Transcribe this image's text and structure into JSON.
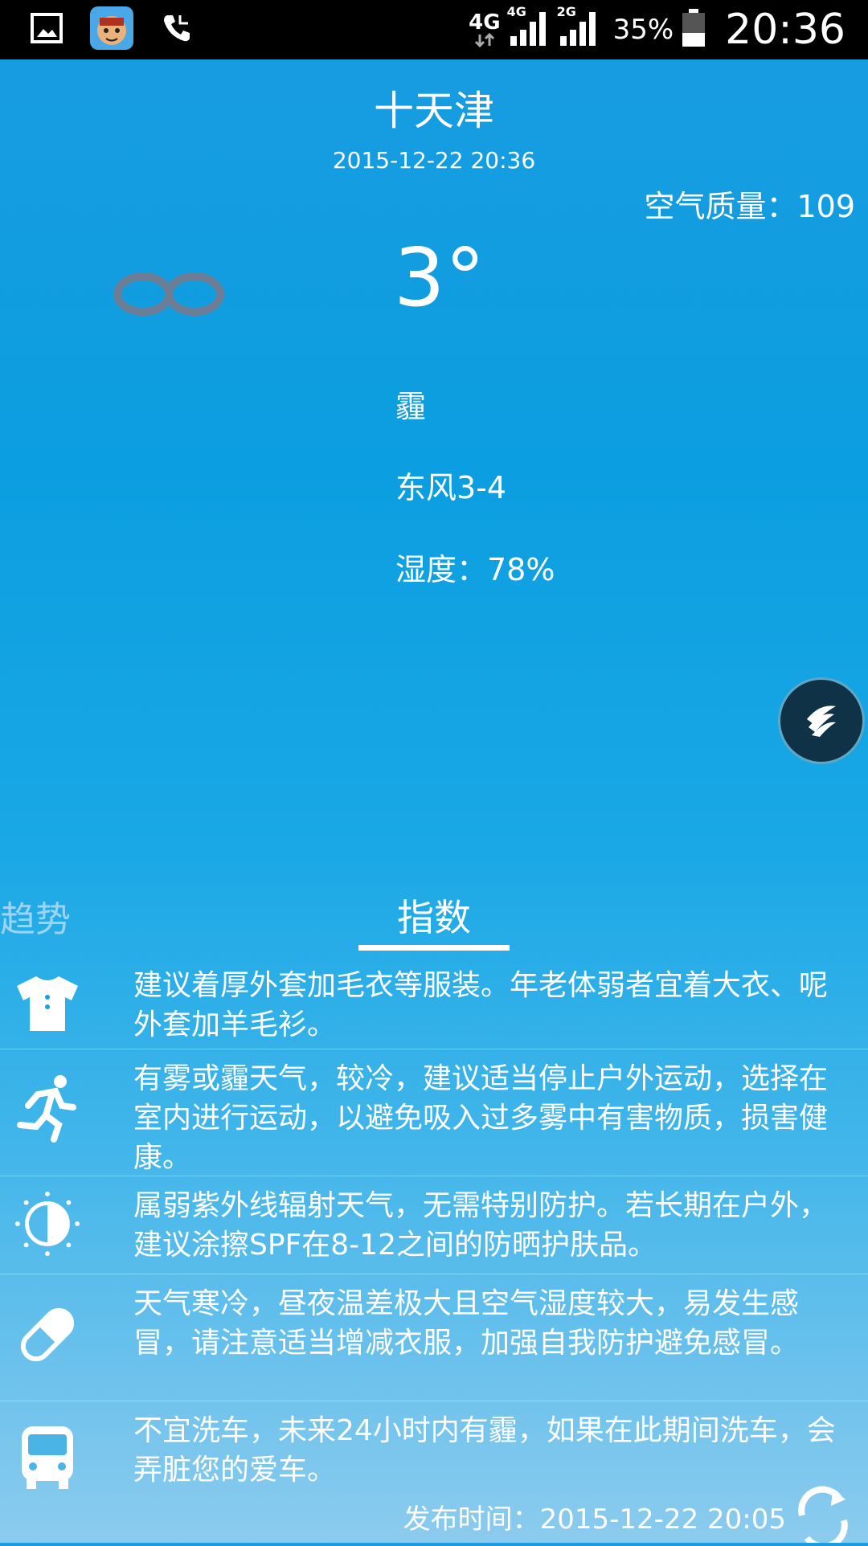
{
  "status_bar": {
    "net_4g": "4G",
    "sig_4g": "4G",
    "sig_2g": "2G",
    "battery": "35%",
    "time": "20:36"
  },
  "header": {
    "city": "十天津",
    "datetime": "2015-12-22  20:36",
    "aqi": "空气质量：109"
  },
  "current": {
    "temperature": "3°",
    "condition": "霾",
    "wind": "东风3-4",
    "humidity": "湿度：78%"
  },
  "tabs": {
    "trend": "趋势",
    "index": "指数"
  },
  "indices": [
    {
      "icon": "shirt-icon",
      "text": "建议着厚外套加毛衣等服装。年老体弱者宜着大衣、呢外套加羊毛衫。"
    },
    {
      "icon": "running-icon",
      "text": "有雾或霾天气，较冷，建议适当停止户外运动，选择在室内进行运动，以避免吸入过多雾中有害物质，损害健康。"
    },
    {
      "icon": "sun-icon",
      "text": "属弱紫外线辐射天气，无需特别防护。若长期在户外，建议涂擦SPF在8-12之间的防晒护肤品。"
    },
    {
      "icon": "pill-icon",
      "text": "天气寒冷，昼夜温差极大且空气湿度较大，易发生感冒，请注意适当增减衣服，加强自我防护避免感冒。"
    },
    {
      "icon": "car-icon",
      "text": "不宜洗车，未来24小时内有霾，如果在此期间洗车，会弄脏您的爱车。"
    }
  ],
  "footer": {
    "publish_time": "发布时间：2015-12-22 20:05"
  }
}
